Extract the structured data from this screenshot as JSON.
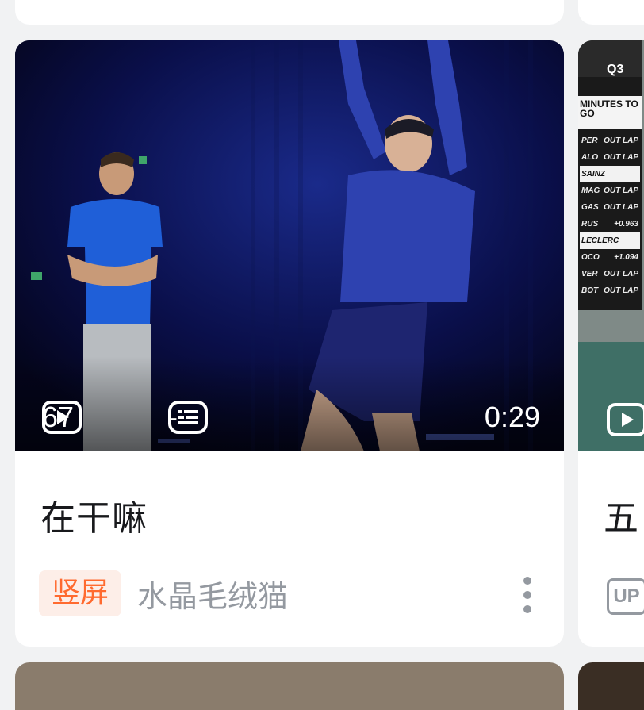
{
  "feed": {
    "main_card": {
      "title": "在干嘛",
      "views": "67",
      "danmaku": "-",
      "duration": "0:29",
      "tag": "竖屏",
      "author": "水晶毛绒猫"
    },
    "right_card": {
      "title": "五",
      "up_badge": "UP",
      "scoreboard": {
        "session": "Q3",
        "minutes_label": "MINUTES TO GO",
        "rows": [
          {
            "driver": "PER",
            "status": "OUT LAP"
          },
          {
            "driver": "ALO",
            "status": "OUT LAP"
          },
          {
            "driver": "SAINZ",
            "status": ""
          },
          {
            "driver": "MAG",
            "status": "OUT LAP"
          },
          {
            "driver": "GAS",
            "status": "OUT LAP"
          },
          {
            "driver": "RUS",
            "status": "+0.963"
          },
          {
            "driver": "LECLERC",
            "status": ""
          },
          {
            "driver": "OCO",
            "status": "+1.094"
          },
          {
            "driver": "VER",
            "status": "OUT LAP"
          },
          {
            "driver": "BOT",
            "status": "OUT LAP"
          }
        ]
      }
    }
  },
  "colors": {
    "page_bg": "#f1f2f3",
    "card_bg": "#ffffff",
    "tag_bg": "#fdeee8",
    "tag_text": "#ff6a2f",
    "secondary_text": "#9499a0",
    "title_text": "#18191c"
  },
  "icons": [
    "play-count-icon",
    "danmaku-icon",
    "more-icon"
  ]
}
